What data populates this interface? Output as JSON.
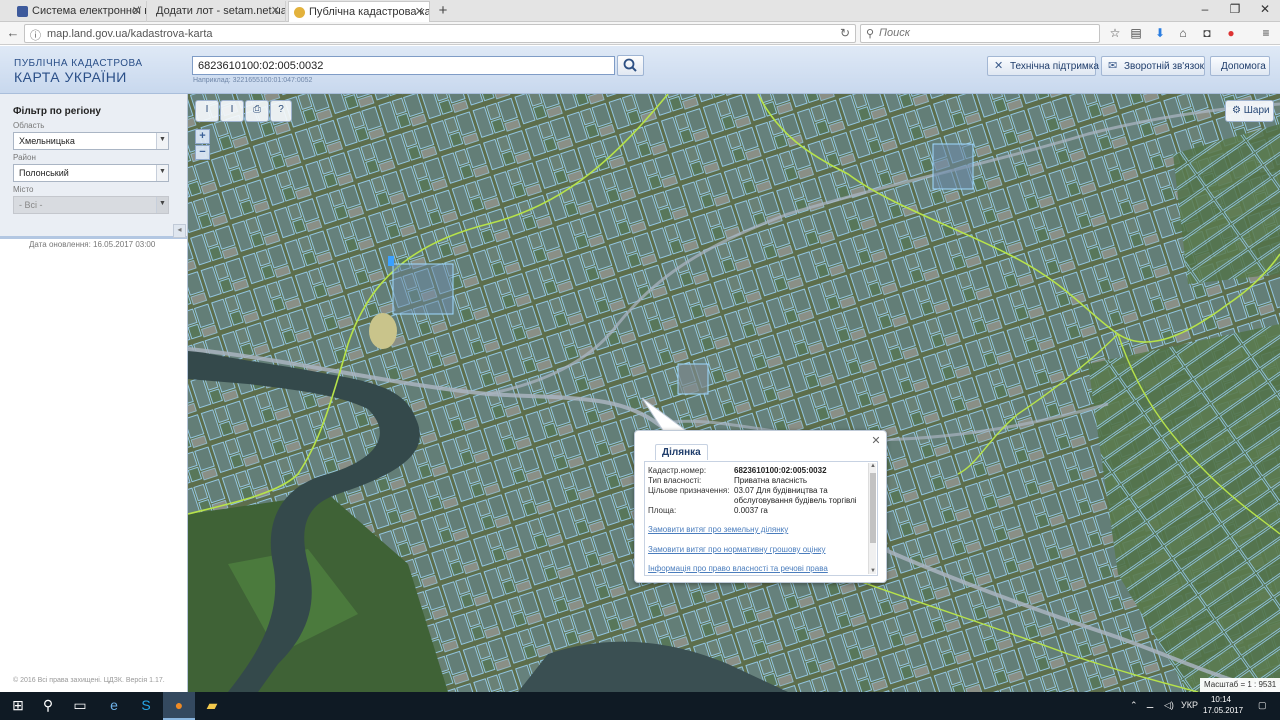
{
  "browser": {
    "tabs": [
      {
        "title": "Система електронної пошт",
        "icon_color": "#3d5a9c",
        "active": false
      },
      {
        "title": "Додати лот - setam.net.ua",
        "icon_color": "#ffffff",
        "active": false
      },
      {
        "title": "Публічна кадастрова карта",
        "icon_color": "#e3b23c",
        "active": true
      }
    ],
    "new_tab": "+",
    "url": "map.land.gov.ua/kadastrova-karta",
    "search_placeholder": "Поиск",
    "window_controls": {
      "minimize": "–",
      "maximize": "❐",
      "close": "✕"
    }
  },
  "header": {
    "logo_line1": "ПУБЛІЧНА КАДАСТРОВА",
    "logo_line2": "КАРТА УКРАЇНИ",
    "search_value": "6823610100:02:005:0032",
    "search_hint": "Наприклад: 3221655100:01:047:0052",
    "buttons": {
      "tech_support": "Технічна підтримка",
      "feedback": "Зворотній зв'язок",
      "help": "Допомога"
    }
  },
  "sidebar": {
    "filter_title": "Фільтр по регіону",
    "oblast_label": "Область",
    "oblast_value": "Хмельницька",
    "rayon_label": "Район",
    "rayon_value": "Полонський",
    "misto_label": "Місто",
    "misto_value": "- Всі -",
    "collapse_glyph": "◂",
    "update_date": "Дата оновлення: 16.05.2017 03:00",
    "copyright": "© 2016 Всі права захищені. ЦДЗК. Версія 1.17."
  },
  "map": {
    "tools": {
      "measure_length": "I",
      "measure_area": "I",
      "print": "⎙",
      "identify": "?"
    },
    "zoom_in": "+",
    "zoom_out": "−",
    "layers_label": "Шари",
    "scale_text": "Масштаб = 1 : 9531",
    "colors": {
      "parcel": "#8fd3ff",
      "boundary": "#b7e34a",
      "road": "#a9b4c0",
      "water": "#3c4f55"
    }
  },
  "popup": {
    "tab": "Ділянка",
    "close": "✕",
    "labels": {
      "cad_number": "Кадастр.номер:",
      "ownership": "Тип власності:",
      "purpose": "Цільове призначення:",
      "area": "Площа:"
    },
    "values": {
      "cad_number": "6823610100:02:005:0032",
      "ownership": "Приватна власність",
      "purpose": "03.07 Для будівництва та обслуговування будівель торгівлі",
      "area": "0.0037 га"
    },
    "links": {
      "extract_land": "Замовити витяг про земельну ділянку",
      "extract_valuation": "Замовити витяг про нормативну грошову оцінку",
      "ownership_info": "Інформація про право власності та речові права"
    }
  },
  "taskbar": {
    "language": "УКР",
    "time": "10:14",
    "date": "17.05.2017"
  }
}
